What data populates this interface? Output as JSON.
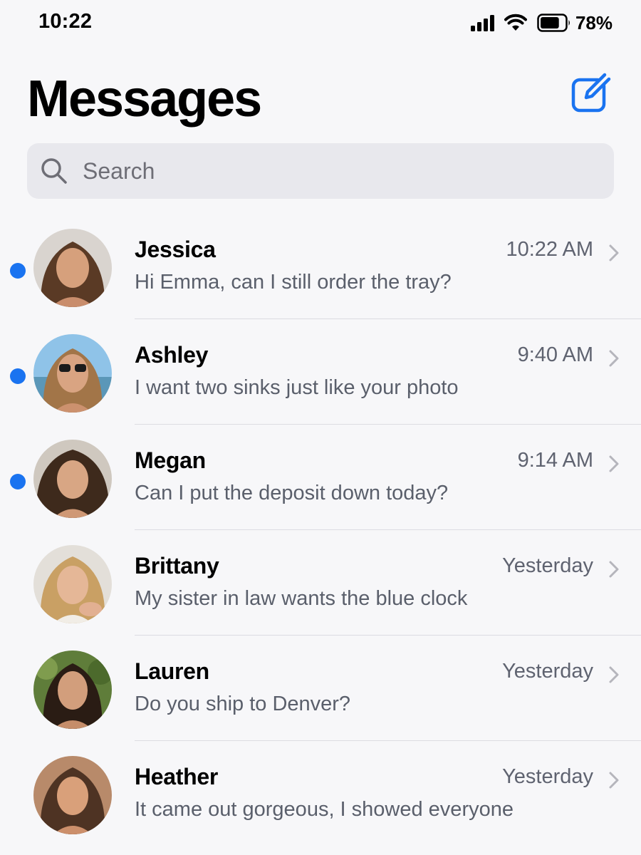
{
  "status_bar": {
    "time": "10:22",
    "battery_percent": "78%",
    "signal_bars": 4,
    "battery_level": 0.78
  },
  "header": {
    "title": "Messages",
    "compose_icon": "compose-icon"
  },
  "search": {
    "placeholder": "Search",
    "icon": "search-icon"
  },
  "colors": {
    "accent": "#1a73f0",
    "unread_dot": "#1a73f0",
    "background": "#f7f7f9",
    "search_bg": "#e8e8ed"
  },
  "conversations": [
    {
      "name": "Jessica",
      "time": "10:22 AM",
      "preview": "Hi Emma, can I still order the tray?",
      "unread": true
    },
    {
      "name": "Ashley",
      "time": "9:40 AM",
      "preview": "I want two sinks just like your photo",
      "unread": true
    },
    {
      "name": "Megan",
      "time": "9:14 AM",
      "preview": "Can I put the deposit down today?",
      "unread": true
    },
    {
      "name": "Brittany",
      "time": "Yesterday",
      "preview": "My sister in law wants the blue clock",
      "unread": false
    },
    {
      "name": "Lauren",
      "time": "Yesterday",
      "preview": "Do you ship to Denver?",
      "unread": false
    },
    {
      "name": "Heather",
      "time": "Yesterday",
      "preview": "It came out gorgeous, I showed everyone",
      "unread": false
    }
  ]
}
